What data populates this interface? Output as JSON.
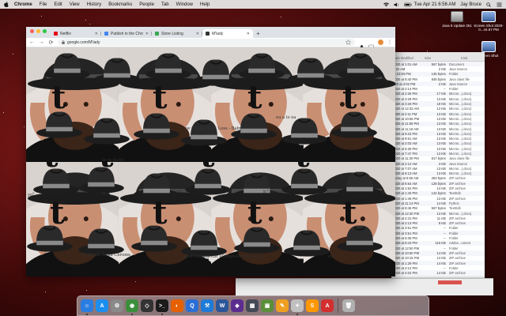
{
  "colors": {
    "desktop_bg": "#6e1414",
    "tab_bar": "#dee1e6",
    "hat_felt": "#2a2a2a",
    "hat_band": "#8a8a8a"
  },
  "menubar": {
    "apple_icon": "apple-icon",
    "app_name": "Chrome",
    "menus": [
      "File",
      "Edit",
      "View",
      "History",
      "Bookmarks",
      "People",
      "Tab",
      "Window",
      "Help"
    ],
    "clock": "Tue Apr 21 6:56 AM",
    "user": "Jay Bruce"
  },
  "desktop": {
    "icons": [
      {
        "label": "Java 8 Update 251",
        "kind": "drive"
      },
      {
        "label": "Screen Shot 2020-0...44.57 PM",
        "kind": "shot"
      },
      {
        "label": "Screen Shot",
        "kind": "shot"
      }
    ]
  },
  "chrome": {
    "tabs": [
      {
        "title": "Netflix",
        "favicon_color": "#e50914",
        "active": false
      },
      {
        "title": "Publish in the Chrome Web St...",
        "favicon_color": "#4285f4",
        "active": false
      },
      {
        "title": "Store Listing",
        "favicon_color": "#34a853",
        "active": false
      },
      {
        "title": "M'lady",
        "favicon_color": "#333333",
        "active": true
      }
    ],
    "url": "google.com/M'lady",
    "new_tab_label": "+",
    "nav": {
      "back": "←",
      "forward": "→",
      "reload": "⟳"
    }
  },
  "content": {
    "tile_char": "t",
    "captions": [
      "ew Google Sign Loss - Baby",
      "lo ra ou lle",
      "eu a lo ea",
      "yo°",
      "arr",
      "h^ba aoo",
      "ay Home. Sena Chrome",
      "ogleContacts cbr aGoogleDoodle Stim",
      "ave"
    ]
  },
  "finder": {
    "headers": [
      "Date Modified",
      "Size",
      "Kind"
    ],
    "rows": [
      [
        "2020 at 1:01 AM",
        "567 bytes",
        "Document"
      ],
      [
        "2:32 AM",
        "2 KB",
        "Java Source"
      ],
      [
        "at 10:04 PM",
        "145 bytes",
        "Folder"
      ],
      [
        "2020 at 9:40 PM",
        "848 bytes",
        "Java class file"
      ],
      [
        "020 at 4:02 PM",
        "2 KB",
        "Java Source"
      ],
      [
        "2020 at 2:14 PM",
        "--",
        "Folder"
      ],
      [
        "2020 at 2:26 PM",
        "17 KB",
        "Micros...(.docx)"
      ],
      [
        "2020 at 3:29 PM",
        "13 KB",
        "Micros...(.docx)"
      ],
      [
        "2020 at 3:26 PM",
        "18 KB",
        "Micros...(.docx)"
      ],
      [
        "2020 at 12:32 AM",
        "13 KB",
        "Micros...(.docx)"
      ],
      [
        "2020 at 2:11 PM",
        "13 KB",
        "Micros...(.docx)"
      ],
      [
        "2020 at 10:56 PM",
        "13 KB",
        "Micros...(.docx)"
      ],
      [
        "2020 at 11:59 PM",
        "13 KB",
        "Micros...(.docx)"
      ],
      [
        "2020 at 11:18 AM",
        "13 KB",
        "Micros...(.docx)"
      ],
      [
        "2020 at 9:23 PM",
        "13 KB",
        "Micros...(.docx)"
      ],
      [
        "2020 at 9:51 AM",
        "13 KB",
        "Micros...(.docx)"
      ],
      [
        "2020 at 2:03 AM",
        "13 KB",
        "Micros...(.docx)"
      ],
      [
        "2020 at 5:30 PM",
        "13 KB",
        "Micros...(.docx)"
      ],
      [
        "2020 at 7:47 PM",
        "13 KB",
        "Micros...(.docx)"
      ],
      [
        "2020 at 11:30 PM",
        "817 bytes",
        "Java class file"
      ],
      [
        "2020 at 2:12 AM",
        "3 KB",
        "Java Source"
      ],
      [
        "2020 at 7:07 AM",
        "13 KB",
        "Micros...(.docx)"
      ],
      [
        "2020 at 6:13 AM",
        "13 KB",
        "Micros...(.docx)"
      ],
      [
        "Today at 6:56 AM",
        "283 bytes",
        "ZIP archive"
      ],
      [
        "2020 at 6:54 AM",
        "128 bytes",
        "ZIP archive"
      ],
      [
        "2020 at 1:54 PM",
        "14 KB",
        "ZIP archive"
      ],
      [
        "2020 at 1:40 PM",
        "142 bytes",
        "TextEdit"
      ],
      [
        "2020 at 1:45 PM",
        "13 KB",
        "ZIP archive"
      ],
      [
        "2020 at 11:13 PM",
        "14 KB",
        "Python"
      ],
      [
        "2020 at 8:46 PM",
        "567 bytes",
        "TextEdit"
      ],
      [
        "2020 at 12:30 PM",
        "13 KB",
        "Micros...(.docx)"
      ],
      [
        "2020 at 2:31 PM",
        "11 KB",
        "ZIP archive"
      ],
      [
        "2020 at 2:13 PM",
        "8 KB",
        "ZIP archive"
      ],
      [
        "2020 at 3:51 PM",
        "--",
        "Folder"
      ],
      [
        "2020 at 3:51 PM",
        "--",
        "Folder"
      ],
      [
        "2020 at 6:36 PM",
        "--",
        "Folder"
      ],
      [
        "2020 at 8:43 PM",
        "116 KB",
        "Adobe...ument"
      ],
      [
        "2020 at 12:50 PM",
        "--",
        "Folder"
      ],
      [
        "2020 at 10:50 PM",
        "14 KB",
        "ZIP archive"
      ],
      [
        "2020 at 10:15 PM",
        "14 KB",
        "ZIP archive"
      ],
      [
        "2020 at 1:29 PM",
        "14 KB",
        "ZIP archive"
      ],
      [
        "2020 at 2:12 PM",
        "--",
        "Folder"
      ],
      [
        "2020 at 4:02 PM",
        "14 KB",
        "ZIP archive"
      ]
    ]
  },
  "dock": {
    "items": [
      {
        "name": "finder",
        "color": "#2a7de1",
        "glyph": "☺"
      },
      {
        "name": "app-store",
        "color": "#1c8ef0",
        "glyph": "A"
      },
      {
        "name": "system-preferences",
        "color": "#8a8a8a",
        "glyph": "⚙"
      },
      {
        "name": "chrome",
        "color": "#3b8e3b",
        "glyph": "◉"
      },
      {
        "name": "unity",
        "color": "#333333",
        "glyph": "◇"
      },
      {
        "name": "terminal",
        "color": "#1b1b1b",
        "glyph": ">_"
      },
      {
        "name": "firefox",
        "color": "#e66000",
        "glyph": "◐"
      },
      {
        "name": "quicktime",
        "color": "#2b6fd6",
        "glyph": "Q"
      },
      {
        "name": "xcode",
        "color": "#1e7bd8",
        "glyph": "⚒"
      },
      {
        "name": "word",
        "color": "#2b579a",
        "glyph": "W"
      },
      {
        "name": "visual-studio",
        "color": "#5c2d91",
        "glyph": "◈"
      },
      {
        "name": "mission-control",
        "color": "#444a55",
        "glyph": "▦"
      },
      {
        "name": "minecraft",
        "color": "#5b8f3a",
        "glyph": "▣"
      },
      {
        "name": "pencil-app",
        "color": "#f0a020",
        "glyph": "✎"
      },
      {
        "name": "script-editor",
        "color": "#c0c0c0",
        "glyph": "✦"
      },
      {
        "name": "sublime-text",
        "color": "#ff9800",
        "glyph": "S"
      },
      {
        "name": "acrobat",
        "color": "#d32f2f",
        "glyph": "A"
      },
      {
        "name": "trash",
        "color": "#b0b0b0",
        "glyph": "🗑"
      }
    ]
  }
}
